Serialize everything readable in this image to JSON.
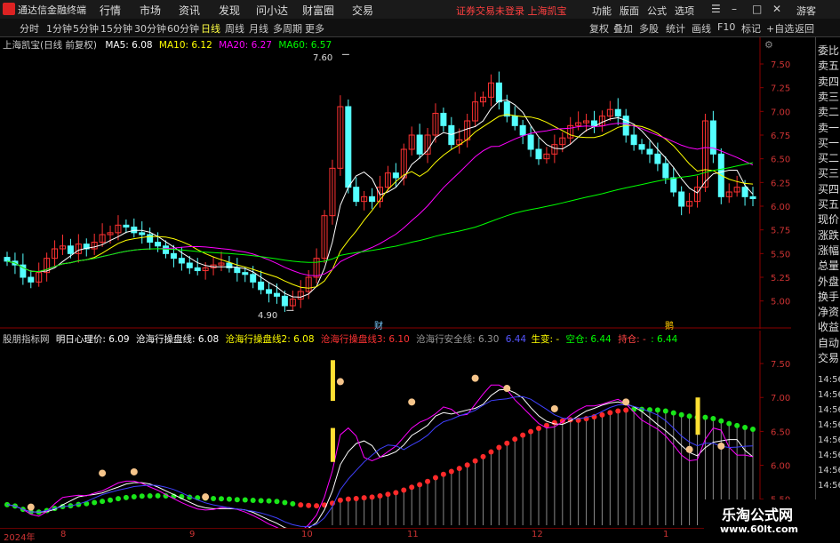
{
  "app": {
    "title": "通达信金融终端"
  },
  "menu": [
    "行情",
    "市场",
    "资讯",
    "发现",
    "问小达",
    "财富圈",
    "交易"
  ],
  "notice": "证券交易未登录 上海凯宝",
  "right_menu": [
    "功能",
    "版面",
    "公式",
    "选项"
  ],
  "guest": "游客",
  "periods": [
    "分时",
    "1分钟",
    "5分钟",
    "15分钟",
    "30分钟",
    "60分钟",
    "日线",
    "周线",
    "月线",
    "多周期",
    "更多"
  ],
  "active_period": "日线",
  "toolbar_right": [
    "复权",
    "叠加",
    "多股",
    "统计",
    "画线",
    "F10",
    "标记",
    "+自选",
    "返回"
  ],
  "main_info": {
    "stock": "上海凯宝(日线 前复权)",
    "ma5": "MA5: 6.08",
    "ma10": "MA10: 6.12",
    "ma20": "MA20: 6.27",
    "ma60": "MA60: 6.57"
  },
  "peak_label": "7.60",
  "trough_label": "4.90",
  "marker_cai": "财",
  "marker_two": "鹅",
  "indicator_info": {
    "name": "股朋指标网",
    "mingri": "明日心理价: 6.09",
    "cangh1": "沧海行操盘线: 6.08",
    "cangh2": "沧海行操盘线2: 6.08",
    "cangh3": "沧海行操盘线3: 6.10",
    "safe": "沧海行安全线: 6.30",
    "val": "6.44",
    "shengbian": "生变: -",
    "kongcang": "空仓: 6.44",
    "chicang": "持仓: -",
    "last": ": 6.44"
  },
  "right_panel_items": [
    "委比",
    "卖五",
    "卖四",
    "卖三",
    "卖二",
    "卖一",
    "买一",
    "买二",
    "买三",
    "买四",
    "买五",
    "现价",
    "涨跌",
    "涨幅",
    "总量",
    "外盘",
    "换手",
    "净资",
    "收益",
    "自动",
    "交易"
  ],
  "right_panel_times": [
    "14:56",
    "14:56",
    "14:56",
    "14:56",
    "14:56",
    "14:56",
    "14:56",
    "14:56"
  ],
  "main_axis_labels": [
    "7.50",
    "7.25",
    "7.00",
    "6.75",
    "6.50",
    "6.25",
    "6.00",
    "5.75",
    "5.50",
    "5.25",
    "5.00"
  ],
  "indicator_axis_labels": [
    "7.50",
    "7.00",
    "6.50",
    "6.00",
    "5.50"
  ],
  "x_axis_labels": [
    "2024年",
    "8",
    "9",
    "10",
    "11",
    "12",
    "1"
  ],
  "watermark": {
    "line1": "乐淘公式网",
    "line2": "www.60lt.com"
  },
  "colors": {
    "up": "#ff3232",
    "down": "#54ffff",
    "ma5": "#ffffff",
    "ma10": "#ffff00",
    "ma20": "#ff00ff",
    "ma60": "#00ff00",
    "safe": "#00ff00",
    "op": "#ff00ff"
  },
  "chart_data": {
    "type": "candlestick",
    "main_ylim": [
      4.8,
      7.65
    ],
    "closes": [
      5.42,
      5.38,
      5.25,
      5.2,
      5.3,
      5.45,
      5.55,
      5.58,
      5.5,
      5.6,
      5.55,
      5.62,
      5.7,
      5.72,
      5.8,
      5.78,
      5.72,
      5.7,
      5.62,
      5.58,
      5.5,
      5.45,
      5.4,
      5.35,
      5.32,
      5.35,
      5.38,
      5.4,
      5.35,
      5.3,
      5.28,
      5.2,
      5.12,
      5.08,
      5.05,
      4.95,
      5.02,
      5.1,
      5.25,
      5.45,
      5.9,
      6.4,
      7.05,
      6.2,
      6.05,
      6.1,
      6.05,
      6.2,
      6.35,
      6.3,
      6.6,
      6.75,
      6.55,
      6.75,
      6.98,
      6.85,
      6.65,
      6.7,
      6.9,
      7.1,
      7.15,
      7.3,
      7.1,
      6.95,
      6.85,
      6.75,
      6.6,
      6.5,
      6.55,
      6.65,
      6.72,
      6.85,
      6.88,
      6.9,
      6.85,
      6.95,
      7.02,
      6.95,
      6.75,
      6.65,
      6.6,
      6.55,
      6.45,
      6.3,
      6.15,
      6.0,
      6.05,
      6.2,
      6.9,
      6.55,
      6.1,
      6.15,
      6.2,
      6.1,
      6.08
    ]
  }
}
